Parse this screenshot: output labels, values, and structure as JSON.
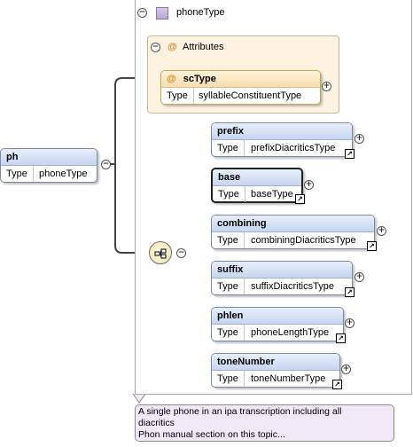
{
  "root_element": {
    "name": "ph",
    "type_label": "Type",
    "type_value": "phoneType"
  },
  "complex_type": {
    "name": "phoneType"
  },
  "attributes_group": {
    "title": "Attributes",
    "attributes": [
      {
        "name": "scType",
        "type_label": "Type",
        "type_value": "syllableConstituentType"
      }
    ]
  },
  "children": [
    {
      "name": "prefix",
      "type_label": "Type",
      "type_value": "prefixDiacriticsType"
    },
    {
      "name": "base",
      "type_label": "Type",
      "type_value": "baseType"
    },
    {
      "name": "combining",
      "type_label": "Type",
      "type_value": "combiningDiacriticsType"
    },
    {
      "name": "suffix",
      "type_label": "Type",
      "type_value": "suffixDiacriticsType"
    },
    {
      "name": "phlen",
      "type_label": "Type",
      "type_value": "phoneLengthType"
    },
    {
      "name": "toneNumber",
      "type_label": "Type",
      "type_value": "toneNumberType"
    }
  ],
  "tooltip": {
    "line1": "A single phone in an ipa transcription including all",
    "line2": "diacritics",
    "line3": "Phon manual section on this topic..."
  },
  "icons": {
    "collapse": "minus-circle-icon",
    "expand": "plus-circle-icon",
    "type": "complex-type-icon",
    "attribute": "at-sign-icon",
    "sequence": "sequence-compositor-icon",
    "link": "link-arrow-icon"
  },
  "colors": {
    "element_header": "#c5d6f0",
    "attribute_header": "#f7ddb0",
    "attributes_group_bg": "#fdf3e0",
    "tooltip_bg": "#f1e9f7"
  }
}
